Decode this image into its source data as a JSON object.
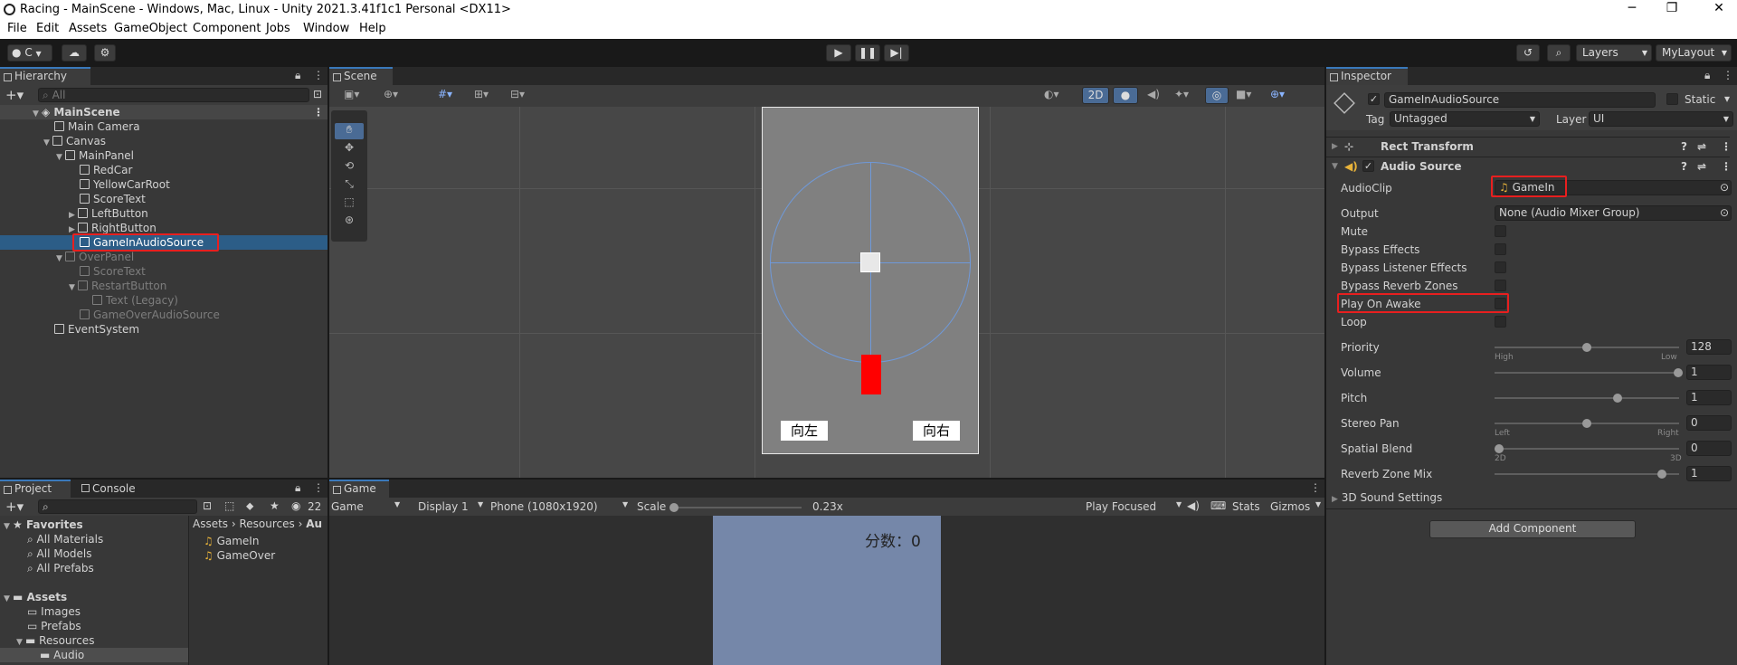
{
  "window": {
    "title": "Racing - MainScene - Windows, Mac, Linux - Unity 2021.3.41f1c1 Personal <DX11>",
    "minimize": "─",
    "maximize": "❐",
    "close": "✕"
  },
  "menu": [
    "File",
    "Edit",
    "Assets",
    "GameObject",
    "Component",
    "Jobs",
    "Window",
    "Help"
  ],
  "toolbar": {
    "account_label": "C",
    "layers_label": "Layers",
    "layout_label": "MyLayout"
  },
  "hierarchy": {
    "tab": "Hierarchy",
    "search_placeholder": "All",
    "scene": "MainScene",
    "items": [
      {
        "label": "Main Camera"
      },
      {
        "label": "Canvas"
      },
      {
        "label": "MainPanel"
      },
      {
        "label": "RedCar"
      },
      {
        "label": "YellowCarRoot"
      },
      {
        "label": "ScoreText"
      },
      {
        "label": "LeftButton"
      },
      {
        "label": "RightButton"
      },
      {
        "label": "GameInAudioSource"
      },
      {
        "label": "OverPanel"
      },
      {
        "label": "ScoreText"
      },
      {
        "label": "RestartButton"
      },
      {
        "label": "Text (Legacy)"
      },
      {
        "label": "GameOverAudioSource"
      },
      {
        "label": "EventSystem"
      }
    ]
  },
  "scene": {
    "tab": "Scene",
    "mode_2d": "2D",
    "left_button": "向左",
    "right_button": "向右"
  },
  "game": {
    "tab": "Game",
    "view": "Game",
    "display": "Display 1",
    "resolution": "Phone (1080x1920)",
    "scale_label": "Scale",
    "scale_value": "0.23x",
    "play_focused": "Play Focused",
    "stats": "Stats",
    "gizmos": "Gizmos",
    "score_text": "分数：0"
  },
  "project": {
    "tab_project": "Project",
    "tab_console": "Console",
    "hidden_count": "22",
    "favorites_header": "Favorites",
    "favorites": [
      "All Materials",
      "All Models",
      "All Prefabs"
    ],
    "assets_header": "Assets",
    "folders": [
      "Images",
      "Prefabs",
      "Resources",
      "Audio"
    ],
    "breadcrumb": [
      "Assets",
      "Resources",
      "Au"
    ],
    "files": [
      "GameIn",
      "GameOver"
    ]
  },
  "inspector": {
    "tab": "Inspector",
    "object_name": "GameInAudioSource",
    "static_label": "Static",
    "tag_label": "Tag",
    "tag_value": "Untagged",
    "layer_label": "Layer",
    "layer_value": "UI",
    "rect_transform": "Rect Transform",
    "audio_source": "Audio Source",
    "audioclip_label": "AudioClip",
    "audioclip_value": "GameIn",
    "output_label": "Output",
    "output_value": "None (Audio Mixer Group)",
    "mute": "Mute",
    "bypass_effects": "Bypass Effects",
    "bypass_listener": "Bypass Listener Effects",
    "bypass_reverb": "Bypass Reverb Zones",
    "play_on_awake": "Play On Awake",
    "loop": "Loop",
    "priority_label": "Priority",
    "priority_value": "128",
    "priority_fraction": 0.5,
    "high": "High",
    "low": "Low",
    "volume_label": "Volume",
    "volume_value": "1",
    "pitch_label": "Pitch",
    "pitch_value": "1",
    "stereo_label": "Stereo Pan",
    "stereo_value": "0",
    "left": "Left",
    "right": "Right",
    "spatial_label": "Spatial Blend",
    "spatial_value": "0",
    "s2d": "2D",
    "s3d": "3D",
    "reverb_label": "Reverb Zone Mix",
    "reverb_value": "1",
    "sound3d": "3D Sound Settings",
    "add_component": "Add Component"
  },
  "colors": {
    "accent": "#3a79bb",
    "highlight": "#e81f1f",
    "selected_row": "#2c5d87",
    "game_bg": "#7587a9"
  }
}
